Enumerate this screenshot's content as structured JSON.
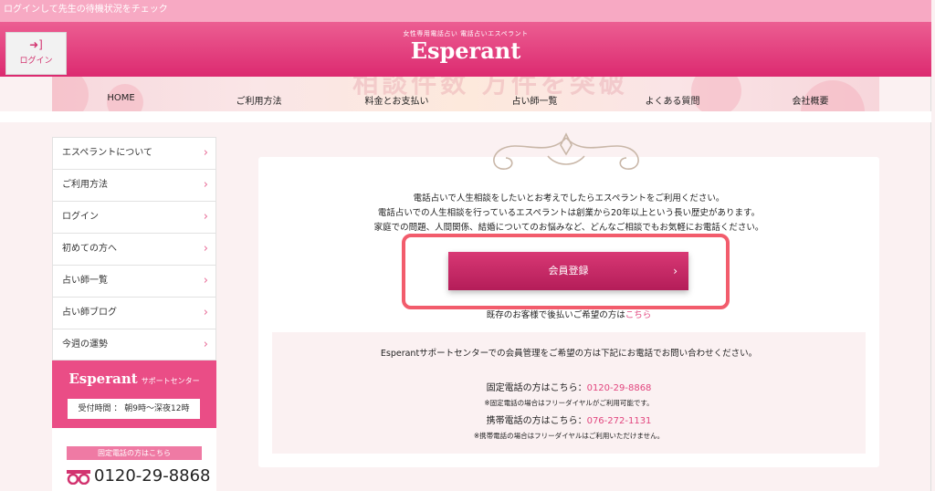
{
  "topbar": {
    "text": "ログインして先生の待機状況をチェック"
  },
  "header": {
    "login_label": "ログイン",
    "tagline": "女性専用電話占い 電話占いエスペラント",
    "brand": "Esperant"
  },
  "banner": {
    "bg_text": "相談件数 万件を突破"
  },
  "nav": {
    "items": [
      "HOME",
      "ご利用方法",
      "料金とお支払い",
      "占い師一覧",
      "よくある質問",
      "会社概要"
    ]
  },
  "sidebar": {
    "items": [
      "エスペラントについて",
      "ご利用方法",
      "ログイン",
      "初めての方へ",
      "占い師一覧",
      "占い師ブログ",
      "今週の運勢"
    ],
    "support_brand": "Esperant",
    "support_suffix": "サポートセンター",
    "hours": "受付時間 ： 朝9時〜深夜12時",
    "fixed_label": "固定電話の方はこちら",
    "fixed_number": "0120-29-8868"
  },
  "main": {
    "intro": [
      "電話占いで人生相談をしたいとお考えでしたらエスペラントをご利用ください。",
      "電話占いでの人生相談を行っているエスペラントは創業から20年以上という長い歴史があります。",
      "家庭での問題、人間関係、結婚についてのお悩みなど、どんなご相談でもお気軽にお電話ください。"
    ],
    "register_label": "会員登録",
    "existing_text": "既存のお客様で後払いご希望の方は",
    "existing_link": "こちら",
    "support_head": "Esperantサポートセンターでの会員管理をご希望の方は下記にお電話でお問い合わせください。",
    "fixed_text": "固定電話の方はこちら：",
    "fixed_number": "0120-29-8868",
    "fixed_note": "※固定電話の場合はフリーダイヤルがご利用可能です。",
    "mobile_text": "携帯電話の方はこちら：",
    "mobile_number": "076-272-1131",
    "mobile_note": "※携帯電話の場合はフリーダイヤルはご利用いただけません。"
  },
  "colors": {
    "brand_pink": "#e2457e",
    "header_pink": "#dc2a70",
    "button": "#b41d59",
    "highlight": "#f25c6c"
  }
}
